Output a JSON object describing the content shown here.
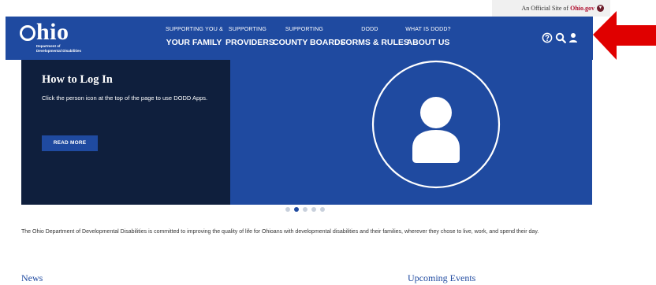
{
  "official": {
    "prefix": "An Official Site of ",
    "brand": "Ohio.gov"
  },
  "header": {
    "logo_word": "hio",
    "logo_sub_line1": "Department of",
    "logo_sub_line2": "Developmental Disabilities",
    "nav": [
      {
        "small": "SUPPORTING YOU &",
        "big": "YOUR FAMILY"
      },
      {
        "small": "SUPPORTING",
        "big": "PROVIDERS"
      },
      {
        "small": "SUPPORTING",
        "big": "COUNTY BOARDS"
      },
      {
        "small": "DODD",
        "big": "FORMS & RULES"
      },
      {
        "small": "WHAT IS DODD?",
        "big": "ABOUT US"
      }
    ],
    "icons": [
      "help-icon",
      "search-icon",
      "user-icon"
    ]
  },
  "hero": {
    "title": "How to Log In",
    "description": "Click the person icon at the top of the page to use DODD Apps.",
    "button": "READ MORE"
  },
  "carousel": {
    "count": 5,
    "active": 2
  },
  "intro": "The Ohio Department of Developmental Disabilities is committed to improving the quality of life for Ohioans with developmental disabilities and their families, wherever they chose to live, work, and spend their day.",
  "sections": {
    "news": "News",
    "events": "Upcoming Events"
  },
  "colors": {
    "brand_blue": "#1f4aa0",
    "hero_dark": "#0f1f3d",
    "annotation_red": "#e00000"
  }
}
